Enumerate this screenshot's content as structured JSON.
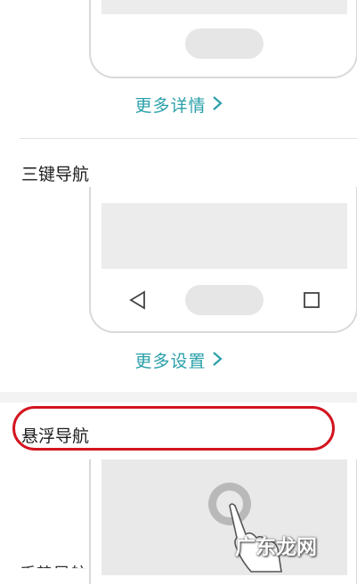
{
  "sections": {
    "top_link": {
      "label": "更多详情"
    },
    "three_key": {
      "title": "三键导航",
      "link": "更多设置"
    },
    "floating": {
      "title": "悬浮导航"
    },
    "next_partial": {
      "title": "手势导航"
    }
  },
  "watermark": "广东龙网",
  "icons": {
    "chevron": "chevron-right-icon",
    "back": "triangle-back-icon",
    "home": "home-pill-icon",
    "recent": "square-recent-icon",
    "gesture": "tap-hand-icon"
  },
  "colors": {
    "link": "#2aa0aa",
    "highlight": "#d3141f"
  }
}
